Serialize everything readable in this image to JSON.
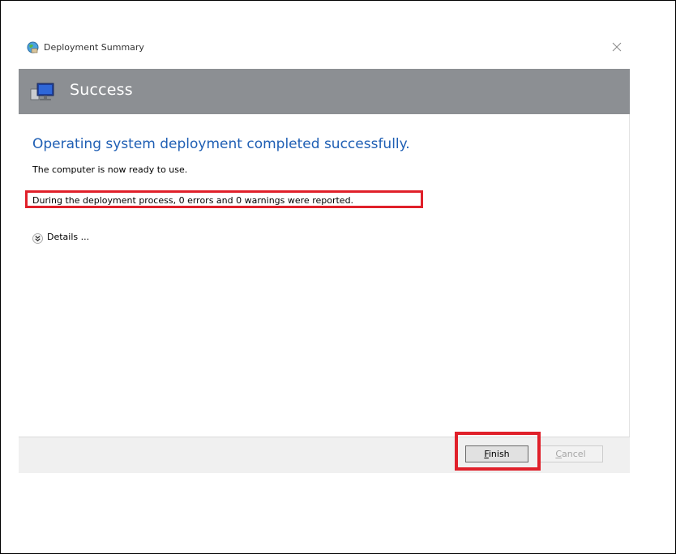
{
  "window": {
    "title": "Deployment Summary"
  },
  "banner": {
    "title": "Success"
  },
  "content": {
    "heading": "Operating system deployment completed successfully.",
    "line1": "The computer is now ready to use.",
    "line2": "During the deployment process, 0 errors and 0 warnings were reported.",
    "details_label": "Details ..."
  },
  "buttons": {
    "finish_first": "F",
    "finish_rest": "inish",
    "cancel_first": "C",
    "cancel_rest": "ancel"
  },
  "colors": {
    "banner_bg": "#8c8f93",
    "heading_text": "#1f5fb4",
    "highlight_red": "#e0202a"
  },
  "icons": {
    "title": "globe-icon",
    "banner": "computer-monitor-icon",
    "details": "chevron-double-down-icon",
    "close": "close-icon"
  }
}
